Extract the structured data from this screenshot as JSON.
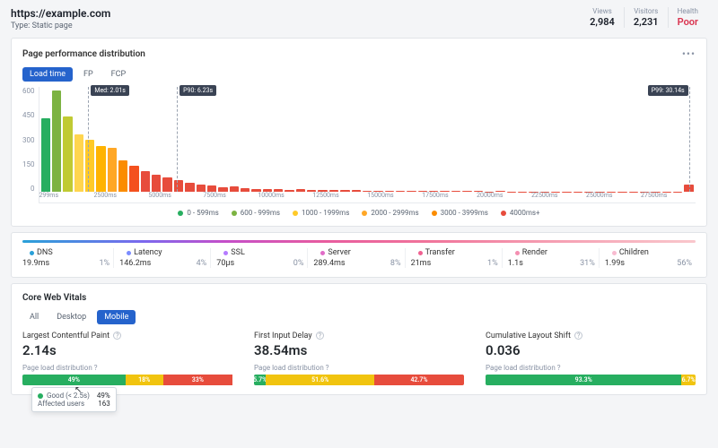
{
  "header": {
    "url": "https://example.com",
    "type_label": "Type:",
    "type_value": "Static page",
    "stats": [
      {
        "label": "Views",
        "value": "2,984"
      },
      {
        "label": "Visitors",
        "value": "2,231"
      },
      {
        "label": "Health",
        "value": "Poor",
        "status": "poor"
      }
    ]
  },
  "perf_card": {
    "title": "Page performance distribution",
    "tabs": [
      "Load time",
      "FP",
      "FCP"
    ],
    "active_tab": 0,
    "markers": {
      "med": "Med: 2.01s",
      "p90": "P90: 6.23s",
      "p99": "P99: 30.14s"
    }
  },
  "chart_data": {
    "type": "bar",
    "title": "Page performance distribution — Load time",
    "ylabel": "",
    "xlabel": "",
    "ylim": [
      0,
      600
    ],
    "y_ticks": [
      0,
      150,
      300,
      450,
      600
    ],
    "x_ticks": [
      "299ms",
      "2500ms",
      "5000ms",
      "7500ms",
      "10000ms",
      "12500ms",
      "15000ms",
      "17500ms",
      "20000ms",
      "22500ms",
      "25000ms",
      "27500ms"
    ],
    "legend": [
      {
        "label": "0 - 599ms",
        "color": "#27ae60"
      },
      {
        "label": "600 - 999ms",
        "color": "#7cb342"
      },
      {
        "label": "1000 - 1999ms",
        "color": "#ffca28"
      },
      {
        "label": "2000 - 2999ms",
        "color": "#ffa726"
      },
      {
        "label": "3000 - 3999ms",
        "color": "#fb8c00"
      },
      {
        "label": "4000ms+",
        "color": "#e74c3c"
      }
    ],
    "bars": [
      {
        "v": 420,
        "c": "#27ae60"
      },
      {
        "v": 580,
        "c": "#7cb342"
      },
      {
        "v": 430,
        "c": "#c0ca33"
      },
      {
        "v": 330,
        "c": "#ffd54f"
      },
      {
        "v": 300,
        "c": "#ffca28"
      },
      {
        "v": 260,
        "c": "#ffb300"
      },
      {
        "v": 250,
        "c": "#ffa726"
      },
      {
        "v": 180,
        "c": "#fb8c00"
      },
      {
        "v": 150,
        "c": "#f4511e"
      },
      {
        "v": 120,
        "c": "#e74c3c"
      },
      {
        "v": 95,
        "c": "#e74c3c"
      },
      {
        "v": 80,
        "c": "#e74c3c"
      },
      {
        "v": 65,
        "c": "#e74c3c"
      },
      {
        "v": 50,
        "c": "#e74c3c"
      },
      {
        "v": 42,
        "c": "#e74c3c"
      },
      {
        "v": 35,
        "c": "#e74c3c"
      },
      {
        "v": 28,
        "c": "#e74c3c"
      },
      {
        "v": 30,
        "c": "#e74c3c"
      },
      {
        "v": 22,
        "c": "#e74c3c"
      },
      {
        "v": 18,
        "c": "#e74c3c"
      },
      {
        "v": 18,
        "c": "#e74c3c"
      },
      {
        "v": 15,
        "c": "#e74c3c"
      },
      {
        "v": 12,
        "c": "#e74c3c"
      },
      {
        "v": 14,
        "c": "#e74c3c"
      },
      {
        "v": 10,
        "c": "#e74c3c"
      },
      {
        "v": 10,
        "c": "#e74c3c"
      },
      {
        "v": 9,
        "c": "#e74c3c"
      },
      {
        "v": 8,
        "c": "#e74c3c"
      },
      {
        "v": 10,
        "c": "#e74c3c"
      },
      {
        "v": 6,
        "c": "#e74c3c"
      },
      {
        "v": 6,
        "c": "#e74c3c"
      },
      {
        "v": 5,
        "c": "#e74c3c"
      },
      {
        "v": 5,
        "c": "#e74c3c"
      },
      {
        "v": 4,
        "c": "#e74c3c"
      },
      {
        "v": 5,
        "c": "#e74c3c"
      },
      {
        "v": 4,
        "c": "#e74c3c"
      },
      {
        "v": 3,
        "c": "#e74c3c"
      },
      {
        "v": 4,
        "c": "#e74c3c"
      },
      {
        "v": 3,
        "c": "#e74c3c"
      },
      {
        "v": 3,
        "c": "#e74c3c"
      },
      {
        "v": 2,
        "c": "#e74c3c"
      },
      {
        "v": 3,
        "c": "#e74c3c"
      },
      {
        "v": 2,
        "c": "#e74c3c"
      },
      {
        "v": 2,
        "c": "#e74c3c"
      },
      {
        "v": 2,
        "c": "#e74c3c"
      },
      {
        "v": 2,
        "c": "#e74c3c"
      },
      {
        "v": 2,
        "c": "#e74c3c"
      },
      {
        "v": 1,
        "c": "#e74c3c"
      },
      {
        "v": 1,
        "c": "#e74c3c"
      },
      {
        "v": 2,
        "c": "#e74c3c"
      },
      {
        "v": 1,
        "c": "#e74c3c"
      },
      {
        "v": 1,
        "c": "#e74c3c"
      },
      {
        "v": 1,
        "c": "#e74c3c"
      },
      {
        "v": 1,
        "c": "#e74c3c"
      },
      {
        "v": 1,
        "c": "#e74c3c"
      },
      {
        "v": 1,
        "c": "#e74c3c"
      },
      {
        "v": 1,
        "c": "#e74c3c"
      },
      {
        "v": 1,
        "c": "#e74c3c"
      },
      {
        "v": 40,
        "c": "#e74c3c"
      }
    ],
    "markers": [
      {
        "label": "Med: 2.01s",
        "pos_pct": 7.5
      },
      {
        "label": "P90: 6.23s",
        "pos_pct": 21
      },
      {
        "label": "P99: 30.14s",
        "pos_pct": 99,
        "align": "right"
      }
    ]
  },
  "timing": [
    {
      "name": "DNS",
      "value": "19.9ms",
      "pct": "1%",
      "color": "#2aa0d8"
    },
    {
      "name": "Latency",
      "value": "146.2ms",
      "pct": "4%",
      "color": "#7b8cff"
    },
    {
      "name": "SSL",
      "value": "70µs",
      "pct": "0%",
      "color": "#b57bff"
    },
    {
      "name": "Server",
      "value": "289.4ms",
      "pct": "8%",
      "color": "#e06cc7"
    },
    {
      "name": "Transfer",
      "value": "21ms",
      "pct": "1%",
      "color": "#f06292"
    },
    {
      "name": "Render",
      "value": "1.1s",
      "pct": "31%",
      "color": "#f48fb1"
    },
    {
      "name": "Children",
      "value": "1.99s",
      "pct": "56%",
      "color": "#f8bbd0"
    }
  ],
  "cwv": {
    "title": "Core Web Vitals",
    "tabs": [
      "All",
      "Desktop",
      "Mobile"
    ],
    "active_tab": 2,
    "sub_label": "Page load distribution",
    "tooltip": {
      "line1_label": "Good (< 2.5s)",
      "line1_val": "49%",
      "line2_label": "Affected users",
      "line2_val": "163"
    },
    "metrics": [
      {
        "title": "Largest Contentful Paint",
        "value": "2.14s",
        "dist": [
          {
            "pct": 49,
            "label": "49%",
            "color": "#27ae60"
          },
          {
            "pct": 18,
            "label": "18%",
            "color": "#f1c40f"
          },
          {
            "pct": 33,
            "label": "33%",
            "color": "#e74c3c"
          }
        ],
        "show_tooltip": true
      },
      {
        "title": "First Input Delay",
        "value": "38.54ms",
        "dist": [
          {
            "pct": 5.7,
            "label": "5.7%",
            "color": "#27ae60"
          },
          {
            "pct": 51.6,
            "label": "51.6%",
            "color": "#f1c40f"
          },
          {
            "pct": 42.7,
            "label": "42.7%",
            "color": "#e74c3c"
          }
        ]
      },
      {
        "title": "Cumulative Layout Shift",
        "value": "0.036",
        "dist": [
          {
            "pct": 93.3,
            "label": "93.3%",
            "color": "#27ae60"
          },
          {
            "pct": 6.7,
            "label": "6.7%",
            "color": "#f1c40f"
          }
        ]
      }
    ]
  }
}
